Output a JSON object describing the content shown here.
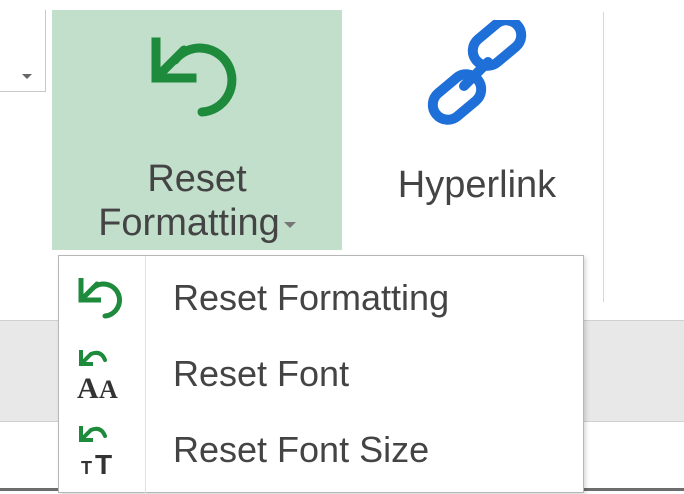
{
  "ribbon": {
    "reset_button": {
      "label_line1": "Reset",
      "label_line2": "Formatting",
      "icon": "reset-formatting-icon"
    },
    "hyperlink_button": {
      "label": "Hyperlink",
      "icon": "hyperlink-icon"
    }
  },
  "menu": {
    "items": [
      {
        "label": "Reset Formatting",
        "icon": "reset-formatting-icon"
      },
      {
        "label": "Reset Font",
        "icon": "reset-font-icon"
      },
      {
        "label": "Reset Font Size",
        "icon": "reset-font-size-icon"
      }
    ]
  },
  "colors": {
    "selected_background": "#c2dfcb",
    "reset_icon_green": "#1e8a3c",
    "hyperlink_blue": "#1f6fd8",
    "text": "#444444"
  }
}
